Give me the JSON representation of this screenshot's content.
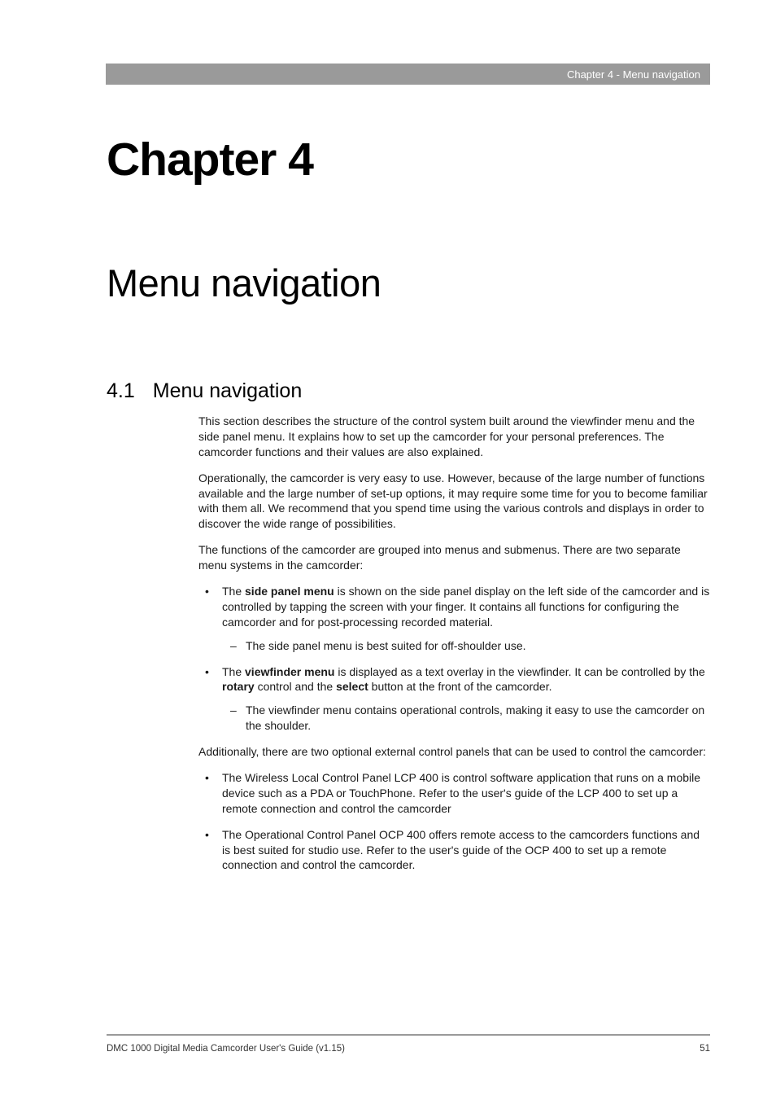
{
  "header": {
    "breadcrumb": "Chapter 4 - Menu navigation"
  },
  "chapter": {
    "title": "Chapter 4"
  },
  "page": {
    "title": "Menu navigation"
  },
  "section": {
    "number": "4.1",
    "title": "Menu navigation"
  },
  "body": {
    "p1": "This section describes the structure of the control system built around the viewfinder menu and the side panel menu. It explains how to set up the camcorder for your personal preferences. The camcorder functions and their values are also explained.",
    "p2": "Operationally, the camcorder is very easy to use. However, because of the large number of functions available and the large number of set-up options, it may require some time for you to become familiar with them all. We recommend that you spend time using the various controls and displays in order to discover the wide range of possibilities.",
    "p3": "The functions of the camcorder are grouped into menus and submenus. There are two separate menu systems in the camcorder:",
    "bullet1_pre": "The ",
    "bullet1_bold": "side panel menu",
    "bullet1_post": " is shown on the side panel display on the left side of the camcorder and is controlled by tapping the screen with your finger. It contains all functions for configuring the camcorder and for post-processing recorded material.",
    "bullet1_sub": "The side panel menu is best suited for off-shoulder use.",
    "bullet2_pre": "The ",
    "bullet2_bold1": "viewfinder menu",
    "bullet2_mid1": " is displayed as a text overlay in the viewfinder. It can be controlled by the ",
    "bullet2_bold2": "rotary",
    "bullet2_mid2": " control and the ",
    "bullet2_bold3": "select",
    "bullet2_post": " button at the front of the camcorder.",
    "bullet2_sub": "The viewfinder menu contains operational controls, making it easy to use the camcorder on the shoulder.",
    "p4": "Additionally, there are two optional external control panels that can be used to control the camcorder:",
    "bullet3": "The Wireless Local Control Panel LCP 400 is control software application that runs on a mobile device such as a PDA or TouchPhone. Refer to the user's guide of the LCP 400 to set up a remote connection and control the camcorder",
    "bullet4": "The Operational Control Panel OCP 400 offers remote access to the camcorders functions and is best suited for studio use. Refer to the user's guide of the OCP 400 to set up a remote connection and control the camcorder."
  },
  "footer": {
    "doc_title": "DMC 1000 Digital Media Camcorder User's Guide (v1.15)",
    "page_number": "51"
  }
}
